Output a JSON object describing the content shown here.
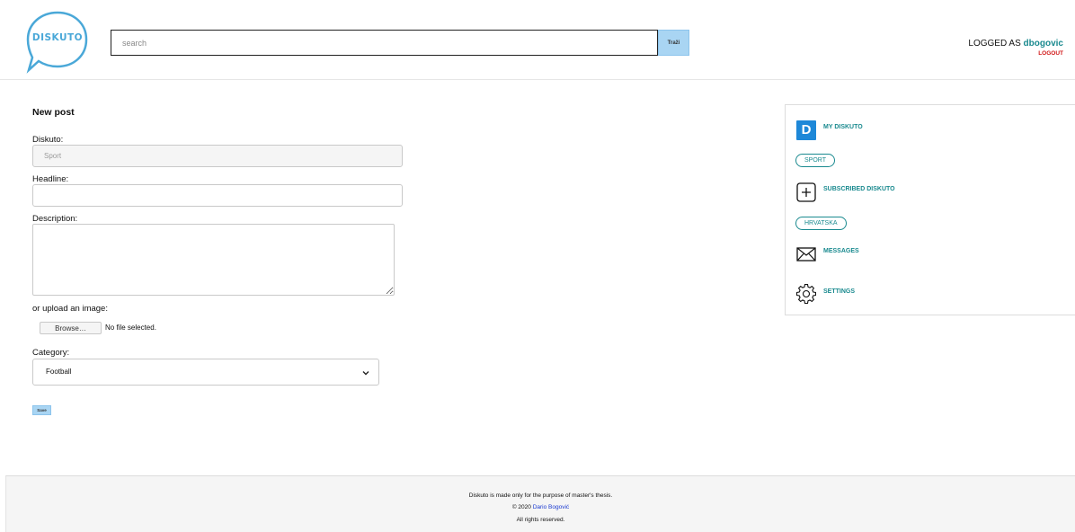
{
  "header": {
    "logo_text": "DISKUTO",
    "search_placeholder": "search",
    "search_button": "Traži",
    "logged_prefix": "LOGGED AS",
    "username": "dbogovic",
    "logout": "LOGOUT"
  },
  "form": {
    "title": "New post",
    "diskuto_label": "Diskuto:",
    "diskuto_value": "Sport",
    "headline_label": "Headline:",
    "headline_value": "",
    "description_label": "Description:",
    "description_value": "",
    "upload_label": "or upload an image:",
    "browse_button": "Browse…",
    "file_status": "No file selected.",
    "category_label": "Category:",
    "category_selected": "Football",
    "save_button": "Save"
  },
  "sidebar": {
    "d_icon_letter": "D",
    "my_diskuto": "MY DISKUTO",
    "my_tags": [
      "SPORT"
    ],
    "subscribed": "SUBSCRIBED DISKUTO",
    "subscribed_tags": [
      "HRVATSKA"
    ],
    "messages": "MESSAGES",
    "settings": "SETTINGS"
  },
  "footer": {
    "line1": "Diskuto is made only for the purpose of master's thesis.",
    "copyright_prefix": "© 2020",
    "author": "Dario Bogović",
    "line3": "All rights reserved."
  },
  "colors": {
    "accent_teal": "#1a8a8f",
    "button_blue": "#a9d5f3",
    "logo_blue": "#4aa8d8",
    "logout_red": "#d01515",
    "link_blue": "#1a3ad0"
  },
  "icons": {
    "logo": "speech-bubble-icon",
    "my_diskuto": "d-square-icon",
    "subscribed": "plus-square-icon",
    "messages": "envelope-icon",
    "settings": "gear-icon",
    "category_select": "chevron-down-icon"
  }
}
